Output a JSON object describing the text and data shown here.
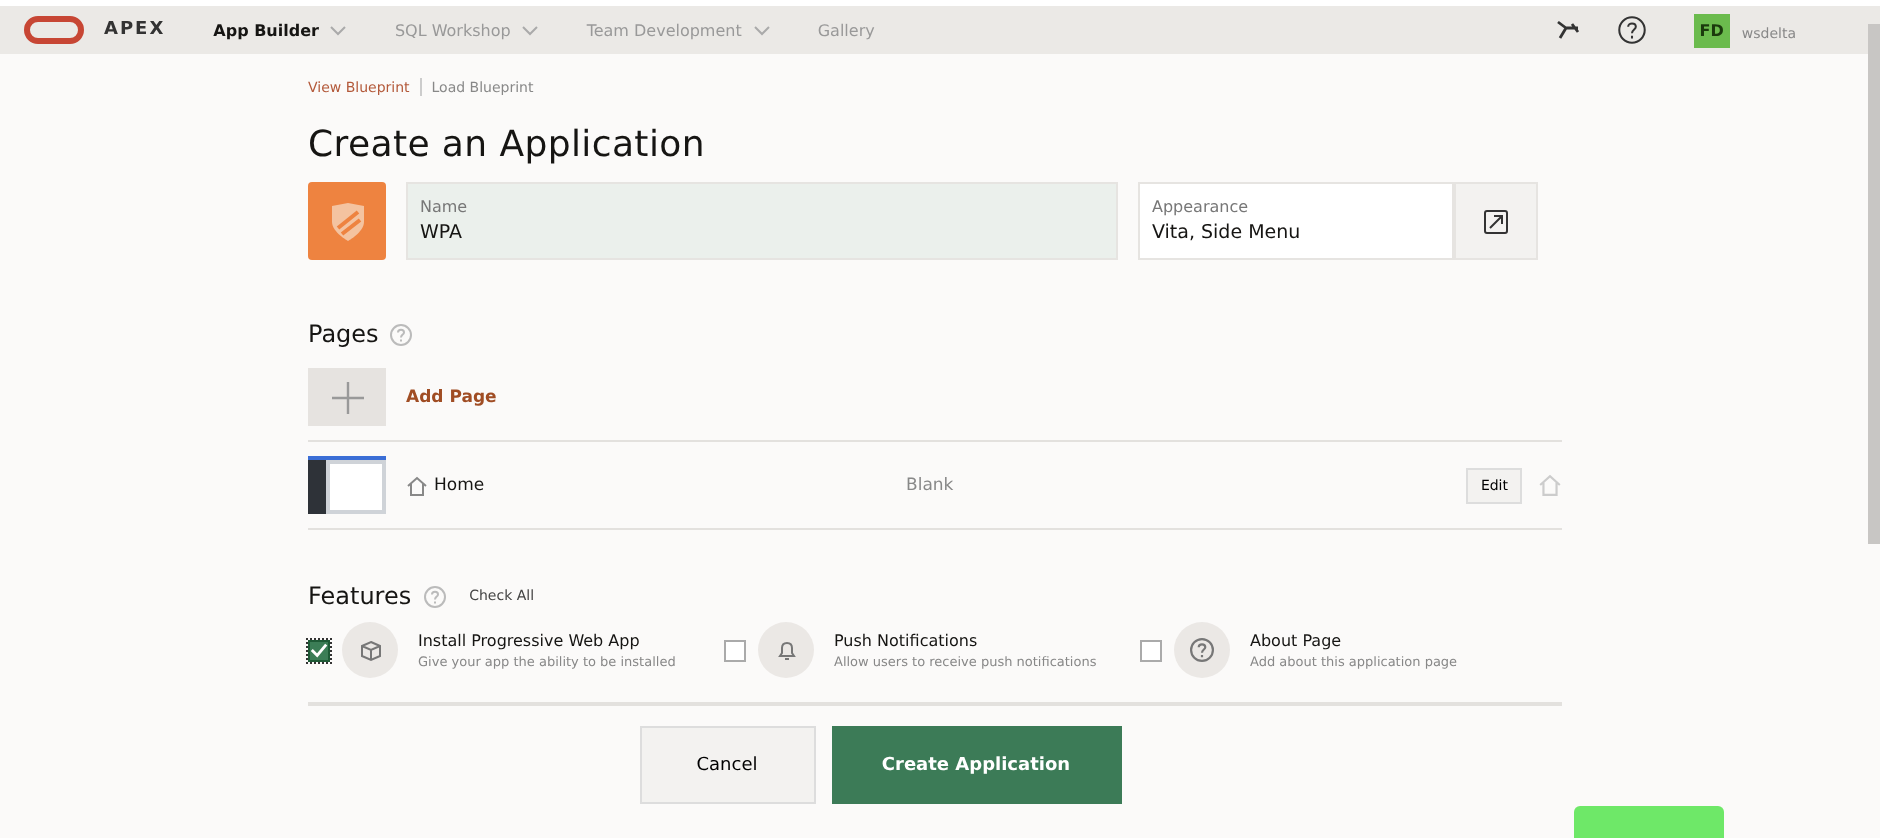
{
  "header": {
    "brand": "APEX",
    "nav": [
      {
        "label": "App Builder",
        "selected": true,
        "has_menu": true
      },
      {
        "label": "SQL Workshop",
        "selected": false,
        "has_menu": true
      },
      {
        "label": "Team Development",
        "selected": false,
        "has_menu": true
      },
      {
        "label": "Gallery",
        "selected": false,
        "has_menu": false
      }
    ],
    "user": {
      "initials": "FD",
      "workspace": "wsdelta"
    }
  },
  "blueprint_links": [
    {
      "label": "View Blueprint",
      "selected": true
    },
    {
      "label": "Load Blueprint",
      "selected": false
    }
  ],
  "title": "Create an Application",
  "name_field": {
    "label": "Name",
    "value": "WPA"
  },
  "appearance_field": {
    "label": "Appearance",
    "value": "Vita, Side Menu"
  },
  "pages": {
    "heading": "Pages",
    "add_label": "Add Page",
    "rows": [
      {
        "name": "Home",
        "type": "Blank",
        "edit": "Edit",
        "home": true
      }
    ]
  },
  "features": {
    "heading": "Features",
    "check_all": "Check All",
    "items": [
      {
        "title": "Install Progressive Web App",
        "description": "Give your app the ability to be installed",
        "checked": true
      },
      {
        "title": "Push Notifications",
        "description": "Allow users to receive push notifications",
        "checked": false
      },
      {
        "title": "About Page",
        "description": "Add about this application page",
        "checked": false
      }
    ]
  },
  "buttons": {
    "cancel": "Cancel",
    "create": "Create Application"
  }
}
